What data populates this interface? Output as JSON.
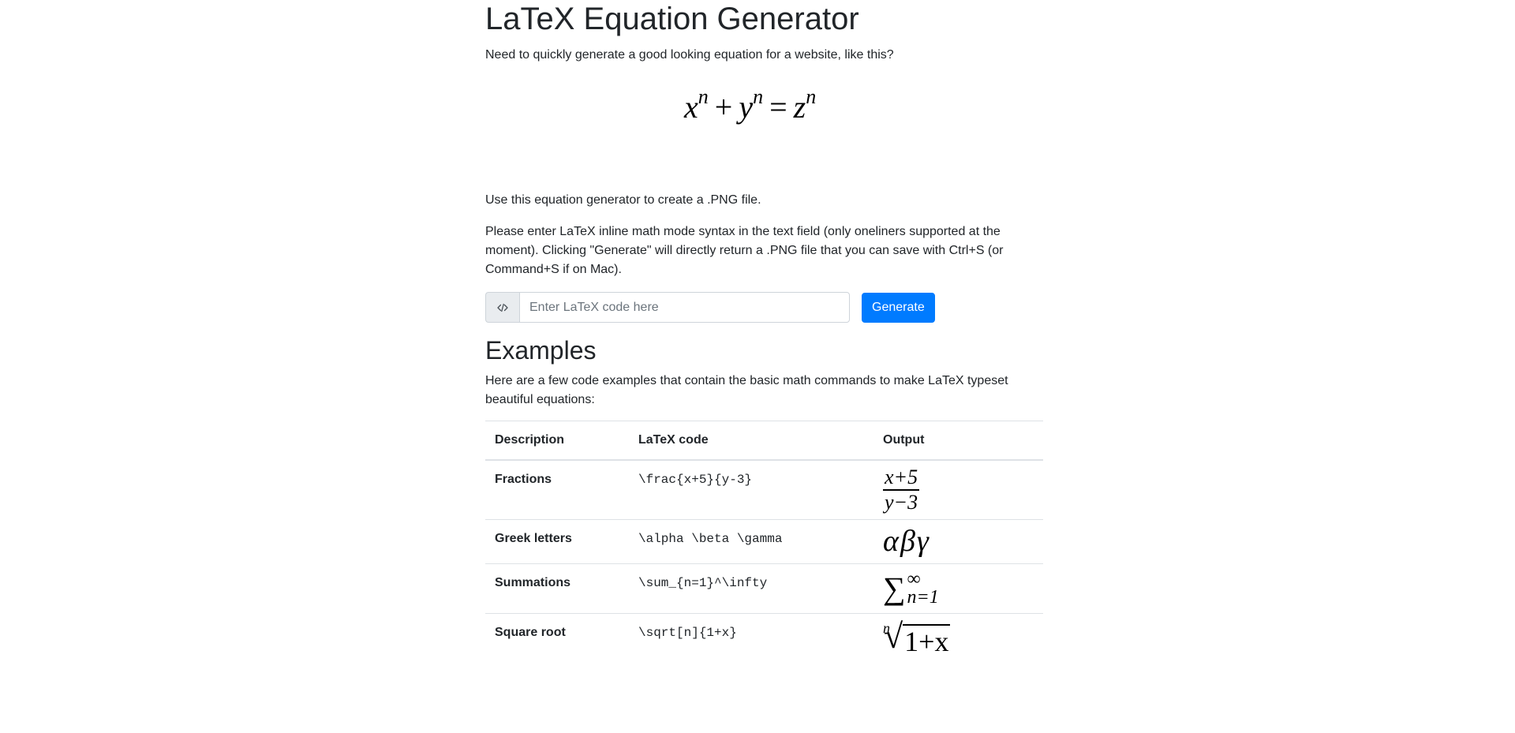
{
  "page": {
    "title": "LaTeX Equation Generator",
    "intro": "Need to quickly generate a good looking equation for a website, like this?",
    "hero_equation": {
      "base1": "x",
      "exp1": "n",
      "plus": "+",
      "base2": "y",
      "exp2": "n",
      "equals": "=",
      "base3": "z",
      "exp3": "n"
    },
    "use_text": "Use this equation generator to create a .PNG file.",
    "instructions": "Please enter LaTeX inline math mode syntax in the text field (only oneliners supported at the moment). Clicking \"Generate\" will directly return a .PNG file that you can save with Ctrl+S (or Command+S if on Mac)."
  },
  "form": {
    "prepend_icon": "code-icon",
    "placeholder": "Enter LaTeX code here",
    "value": "",
    "button_label": "Generate",
    "accent_color": "#007bff"
  },
  "examples": {
    "heading": "Examples",
    "description": "Here are a few code examples that contain the basic math commands to make LaTeX typeset beautiful equations:",
    "columns": [
      "Description",
      "LaTeX code",
      "Output"
    ],
    "rows": [
      {
        "description": "Fractions",
        "code": "\\frac{x+5}{y-3}",
        "output": {
          "num": "x+5",
          "den": "y−3"
        }
      },
      {
        "description": "Greek letters",
        "code": "\\alpha \\beta \\gamma",
        "output": {
          "text": "αβγ"
        }
      },
      {
        "description": "Summations",
        "code": "\\sum_{n=1}^\\infty",
        "output": {
          "symbol": "∑",
          "upper": "∞",
          "lower": "n=1"
        }
      },
      {
        "description": "Square root",
        "code": "\\sqrt[n]{1+x}",
        "output": {
          "index": "n",
          "radical": "√",
          "radicand": "1+x"
        }
      }
    ]
  }
}
